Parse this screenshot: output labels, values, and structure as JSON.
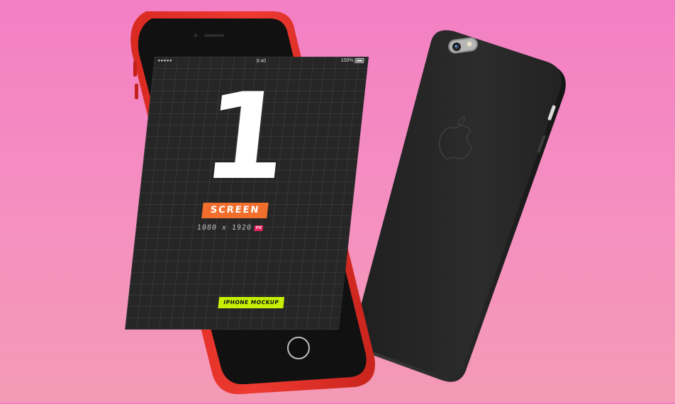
{
  "colors": {
    "background_top": "#f37fc4",
    "background_bottom": "#f39ab4",
    "case_red": "#e8352f",
    "back_phone": "#2a2a2a",
    "screen": "#262626",
    "screen_badge": "#f26e2d",
    "mockup_badge": "#c6f000",
    "px_badge": "#e5245c"
  },
  "front_phone": {
    "status_bar": {
      "signal": "●●●●●",
      "time": "9:40",
      "battery": "100%"
    },
    "big_number": "1",
    "screen_label": "SCREEN",
    "resolution": "1080 x 1920",
    "unit_badge": "PX",
    "mockup_label": "IPHONE MOCKUP",
    "home_button_icon": "home-button-icon",
    "speaker_icon": "earpiece-speaker-icon",
    "camera_icon": "front-camera-icon"
  },
  "back_phone": {
    "logo_icon": "apple-logo-icon",
    "camera_icon": "rear-camera-icon",
    "flash_icon": "flash-icon"
  }
}
